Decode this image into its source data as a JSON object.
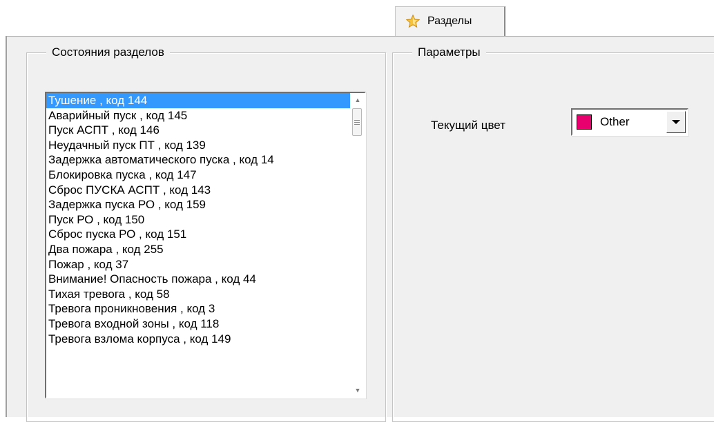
{
  "tabs": [
    {
      "label": "Разделы",
      "icon": "star-icon",
      "active": true
    }
  ],
  "states_group": {
    "title": "Состояния разделов",
    "items": [
      "Тушение , код 144",
      "Аварийный пуск , код 145",
      "Пуск АСПТ , код 146",
      "Неудачный пуск ПТ , код 139",
      "Задержка автоматического пуска , код 14",
      "Блокировка пуска , код 147",
      "Сброс ПУСКА АСПТ , код 143",
      "Задержка пуска РО , код 159",
      "Пуск РО , код 150",
      "Сброс пуска РО , код 151",
      "Два пожара , код 255",
      "Пожар , код 37",
      "Внимание! Опасность пожара , код 44",
      "Тихая тревога , код 58",
      "Тревога проникновения , код 3",
      "Тревога входной зоны , код 118",
      "Тревога взлома корпуса , код 149"
    ],
    "selected_index": 0
  },
  "params_group": {
    "title": "Параметры",
    "color_label": "Текущий цвет",
    "color_value": "Other",
    "color_swatch": "#e8006e"
  }
}
